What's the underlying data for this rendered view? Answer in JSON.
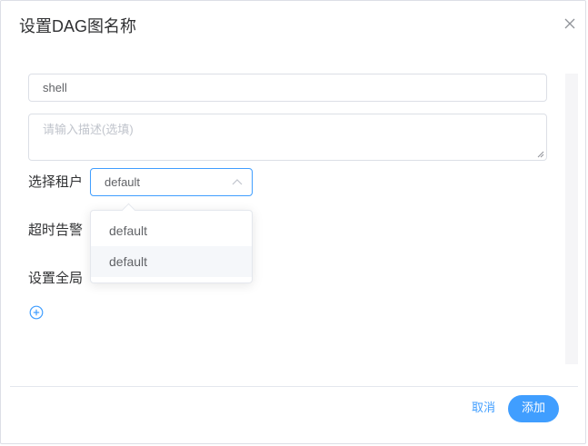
{
  "dialog": {
    "title": "设置DAG图名称"
  },
  "form": {
    "name_value": "shell",
    "description_placeholder": "请输入描述(选填)",
    "tenant_label": "选择租户",
    "tenant_selected": "default",
    "timeout_label": "超时告警",
    "global_label": "设置全局"
  },
  "dropdown": {
    "options": [
      "default",
      "default"
    ]
  },
  "footer": {
    "cancel_label": "取消",
    "add_label": "添加"
  },
  "colors": {
    "accent": "#409eff",
    "text": "#303133"
  },
  "icons": {
    "close": "close-icon",
    "select_arrow": "chevron-up-icon",
    "add": "plus-circle-icon"
  }
}
